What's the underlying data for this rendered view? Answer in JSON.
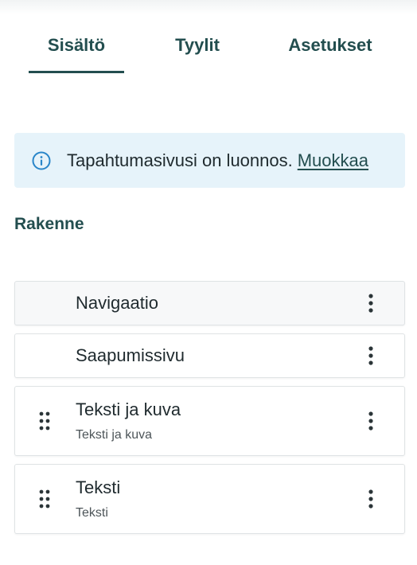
{
  "tabs": [
    {
      "label": "Sisältö",
      "active": true
    },
    {
      "label": "Tyylit",
      "active": false
    },
    {
      "label": "Asetukset",
      "active": false
    }
  ],
  "notice": {
    "text": "Tapahtumasivusi on luonnos.",
    "link": "Muokkaa",
    "icon": "info-icon"
  },
  "section": {
    "title": "Rakenne"
  },
  "items": [
    {
      "label": "Navigaatio",
      "sublabel": "",
      "draggable": false
    },
    {
      "label": "Saapumissivu",
      "sublabel": "",
      "draggable": false
    },
    {
      "label": "Teksti ja kuva",
      "sublabel": "Teksti ja kuva",
      "draggable": true
    },
    {
      "label": "Teksti",
      "sublabel": "Teksti",
      "draggable": true
    }
  ],
  "colors": {
    "accent": "#234e4f",
    "notice_bg": "#e6f3fa",
    "info_icon": "#2a86c9"
  }
}
